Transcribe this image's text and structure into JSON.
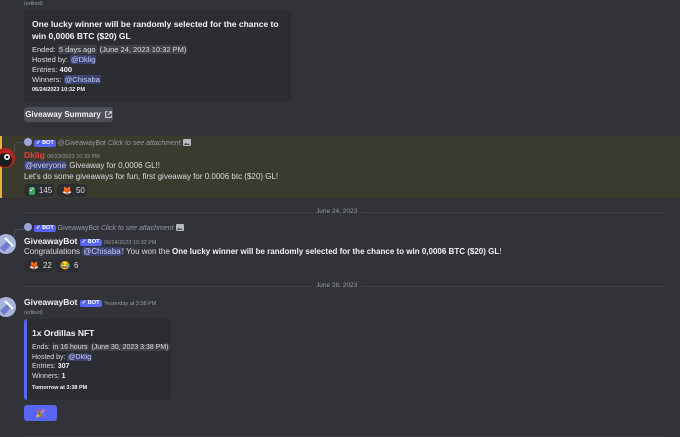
{
  "msg1": {
    "edited": "(edited)",
    "embed_title": "One lucky winner will be randomly selected for the chance to win 0,0006 BTC ($20) GL",
    "ended_label": "Ended:",
    "ended_rel": "5 days ago",
    "ended_abs": "(June 24, 2023 10:32 PM)",
    "hosted_label": "Hosted by:",
    "hosted_by": "@Dklig",
    "entries_label": "Entries:",
    "entries": "400",
    "winners_label": "Winners:",
    "winner": "@Chisaba",
    "footer": "06/24/2023 10:32 PM",
    "button_label": "Giveaway Summary"
  },
  "msg2": {
    "reply_author": "@GiveawayBot",
    "reply_text": "Click to see attachment",
    "author": "Dklig",
    "timestamp": "06/23/2023 10:33 PM",
    "mention": "@everyone",
    "line1_rest": " Giveaway for 0,0006 GL!!",
    "line2": "Let's do some giveaways for fun, first giveaway for 0.0006 btc ($20) GL!",
    "reactions": [
      {
        "emoji": "✅",
        "count": "145"
      },
      {
        "emoji": "🦊",
        "count": "50"
      }
    ]
  },
  "divider1": "June 24, 2023",
  "msg3": {
    "reply_author": "GiveawayBot",
    "reply_text": "Click to see attachment",
    "author": "GiveawayBot",
    "badge": "BOT",
    "timestamp": "06/24/2023 10:32 PM",
    "text_a": "Congratulations ",
    "mention": "@Chisaba",
    "text_b": "! You won the ",
    "text_bold": "One lucky winner will be randomly selected for the chance to win 0,0006 BTC ($20) GL",
    "text_c": "!",
    "reactions": [
      {
        "emoji": "🦊",
        "count": "22"
      },
      {
        "emoji": "😂",
        "count": "6"
      }
    ]
  },
  "divider2": "June 28, 2023",
  "msg4": {
    "author": "GiveawayBot",
    "badge": "BOT",
    "timestamp": "Yesterday at 3:38 PM",
    "edited": "(edited)",
    "embed_title": "1x Ordillas NFT",
    "ends_label": "Ends:",
    "ends_rel": "in 16 hours",
    "ends_abs": "(June 30, 2023 3:38 PM)",
    "hosted_label": "Hosted by:",
    "hosted_by": "@Dklig",
    "entries_label": "Entries:",
    "entries": "307",
    "winners_label": "Winners:",
    "winners": "1",
    "footer": "Tomorrow at 3:38 PM",
    "button_emoji": "🎉"
  },
  "colors": {
    "accent": "#5865f2",
    "highlight_bg": "#3a3a2e",
    "dklig_name": "#e0463a"
  }
}
